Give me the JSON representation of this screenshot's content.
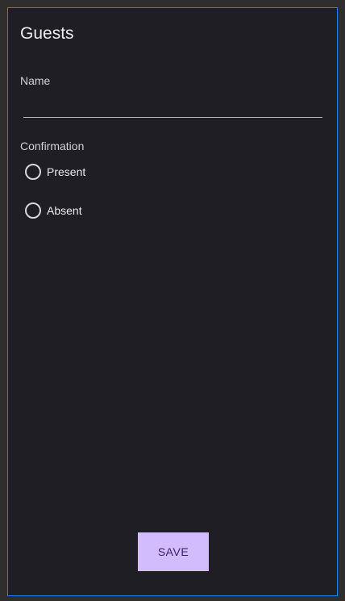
{
  "form": {
    "title": "Guests",
    "name_label": "Name",
    "name_value": "",
    "confirmation_label": "Confirmation",
    "options": [
      {
        "label": "Present",
        "selected": false
      },
      {
        "label": "Absent",
        "selected": false
      }
    ],
    "save_label": "SAVE"
  },
  "colors": {
    "background": "#1f1e24",
    "frame_border": "#2b7fd6",
    "button_bg": "#d3bcfd",
    "button_text": "#3a1f6e"
  }
}
